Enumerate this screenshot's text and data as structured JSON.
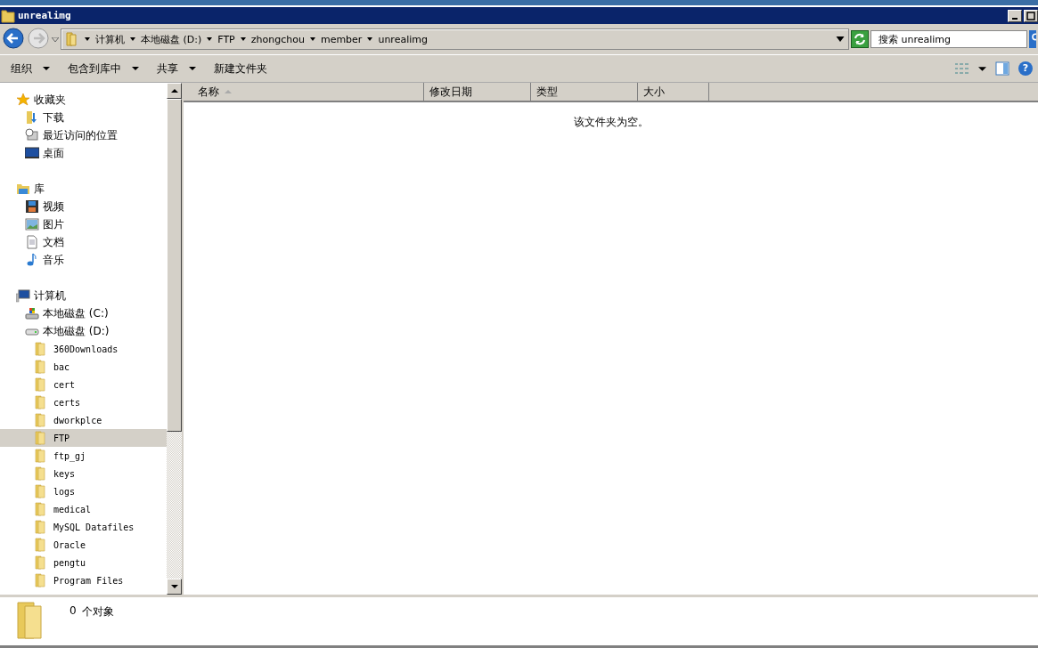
{
  "window": {
    "title": "unrealimg"
  },
  "address_bar": {
    "crumbs": [
      "计算机",
      "本地磁盘 (D:)",
      "FTP",
      "zhongchou",
      "member",
      "unrealimg"
    ]
  },
  "search": {
    "placeholder": "搜索 unrealimg"
  },
  "toolbar": {
    "items": [
      {
        "label": "组织",
        "dropdown": true
      },
      {
        "label": "包含到库中",
        "dropdown": true
      },
      {
        "label": "共享",
        "dropdown": true
      },
      {
        "label": "新建文件夹",
        "dropdown": false
      }
    ]
  },
  "sidebar": {
    "sections": [
      {
        "label": "收藏夹",
        "kind": "star",
        "selected": false,
        "children": [
          {
            "label": "下载",
            "kind": "download",
            "selected": false
          },
          {
            "label": "最近访问的位置",
            "kind": "recent",
            "selected": false
          },
          {
            "label": "桌面",
            "kind": "desktop",
            "selected": false
          }
        ]
      },
      {
        "label": "库",
        "kind": "library",
        "selected": false,
        "children": [
          {
            "label": "视频",
            "kind": "video",
            "selected": false
          },
          {
            "label": "图片",
            "kind": "picture",
            "selected": false
          },
          {
            "label": "文档",
            "kind": "document",
            "selected": false
          },
          {
            "label": "音乐",
            "kind": "music",
            "selected": false
          }
        ]
      },
      {
        "label": "计算机",
        "kind": "computer",
        "selected": false,
        "children": [
          {
            "label": "本地磁盘 (C:)",
            "kind": "system-drive",
            "selected": false
          },
          {
            "label": "本地磁盘 (D:)",
            "kind": "drive",
            "selected": false,
            "children": [
              {
                "label": "360Downloads",
                "kind": "folder",
                "selected": false
              },
              {
                "label": "bac",
                "kind": "folder",
                "selected": false
              },
              {
                "label": "cert",
                "kind": "folder",
                "selected": false
              },
              {
                "label": "certs",
                "kind": "folder",
                "selected": false
              },
              {
                "label": "dworkplce",
                "kind": "folder",
                "selected": false
              },
              {
                "label": "FTP",
                "kind": "folder",
                "selected": true
              },
              {
                "label": "ftp_gj",
                "kind": "folder",
                "selected": false
              },
              {
                "label": "keys",
                "kind": "folder",
                "selected": false
              },
              {
                "label": "logs",
                "kind": "folder",
                "selected": false
              },
              {
                "label": "medical",
                "kind": "folder",
                "selected": false
              },
              {
                "label": "MySQL Datafiles",
                "kind": "folder",
                "selected": false
              },
              {
                "label": "Oracle",
                "kind": "folder",
                "selected": false
              },
              {
                "label": "pengtu",
                "kind": "folder",
                "selected": false
              },
              {
                "label": "Program Files",
                "kind": "folder",
                "selected": false
              }
            ]
          }
        ]
      }
    ]
  },
  "table": {
    "columns": [
      {
        "label": "名称",
        "sorted": true
      },
      {
        "label": "修改日期",
        "sorted": false
      },
      {
        "label": "类型",
        "sorted": false
      },
      {
        "label": "大小",
        "sorted": false
      }
    ],
    "empty_message": "该文件夹为空。"
  },
  "help_button": {
    "label": "?"
  },
  "status_bar": {
    "count": "0",
    "label": "个对象"
  }
}
